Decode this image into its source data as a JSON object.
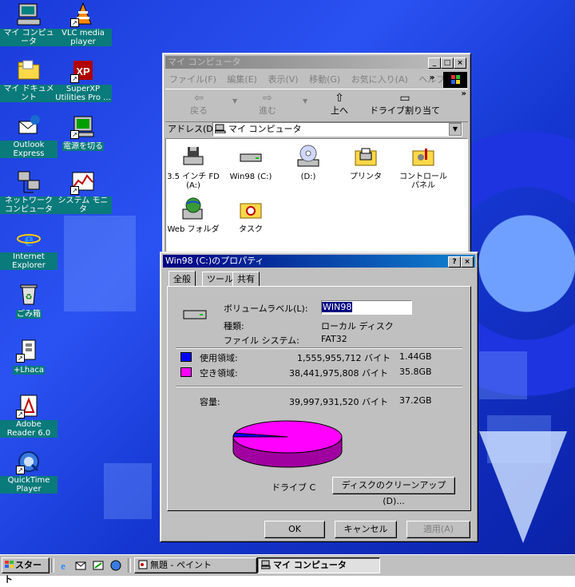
{
  "desktop": {
    "icons": [
      {
        "label": "マイ コンピュータ"
      },
      {
        "label": "VLC media player"
      },
      {
        "label": "マイ ドキュメント"
      },
      {
        "label": "SuperXP Utilities Pro ..."
      },
      {
        "label": "Outlook Express"
      },
      {
        "label": "電源を切る"
      },
      {
        "label": "ネットワーク コンピュータ"
      },
      {
        "label": "システム モニタ"
      },
      {
        "label": "Internet Explorer"
      },
      {
        "label": "ごみ箱"
      },
      {
        "label": "+Lhaca"
      },
      {
        "label": "Adobe Reader 6.0"
      },
      {
        "label": "QuickTime Player"
      }
    ]
  },
  "explorer": {
    "title": "マイ コンピュータ",
    "menu": [
      "ファイル(F)",
      "編集(E)",
      "表示(V)",
      "移動(G)",
      "お気に入り(A)",
      "ヘルプ"
    ],
    "toolbar": {
      "back": "戻る",
      "forward": "進む",
      "up": "上へ",
      "map_drive": "ドライブ割り当て"
    },
    "address_label": "アドレス(D)",
    "address_value": "マイ コンピュータ",
    "items": [
      {
        "label": "3.5 インチ FD (A:)"
      },
      {
        "label": "Win98 (C:)"
      },
      {
        "label": "(D:)"
      },
      {
        "label": "プリンタ"
      },
      {
        "label": "コントロール パネル"
      },
      {
        "label": "Web フォルダ"
      },
      {
        "label": "タスク"
      }
    ]
  },
  "props": {
    "title": "Win98 (C:)のプロパティ",
    "tabs": [
      "全般",
      "ツール",
      "共有"
    ],
    "volume_label_caption": "ボリュームラベル(L):",
    "volume_label_value": "WIN98",
    "type_caption": "種類:",
    "type_value": "ローカル ディスク",
    "fs_caption": "ファイル システム:",
    "fs_value": "FAT32",
    "used_caption": "使用領域:",
    "used_bytes": "1,555,955,712 バイト",
    "used_gb": "1.44GB",
    "free_caption": "空き領域:",
    "free_bytes": "38,441,975,808 バイト",
    "free_gb": "35.8GB",
    "capacity_caption": "容量:",
    "capacity_bytes": "39,997,931,520 バイト",
    "capacity_gb": "37.2GB",
    "drive_caption": "ドライブ C",
    "cleanup_label": "ディスクのクリーンアップ(D)...",
    "ok_label": "OK",
    "cancel_label": "キャンセル",
    "apply_label": "適用(A)",
    "used_color": "#0000ff",
    "free_color": "#ff00ff",
    "used_fraction": 0.0389
  },
  "taskbar": {
    "start_label": "スタート",
    "tasks": [
      "無題 - ペイント",
      "マイ コンピュータ"
    ]
  }
}
